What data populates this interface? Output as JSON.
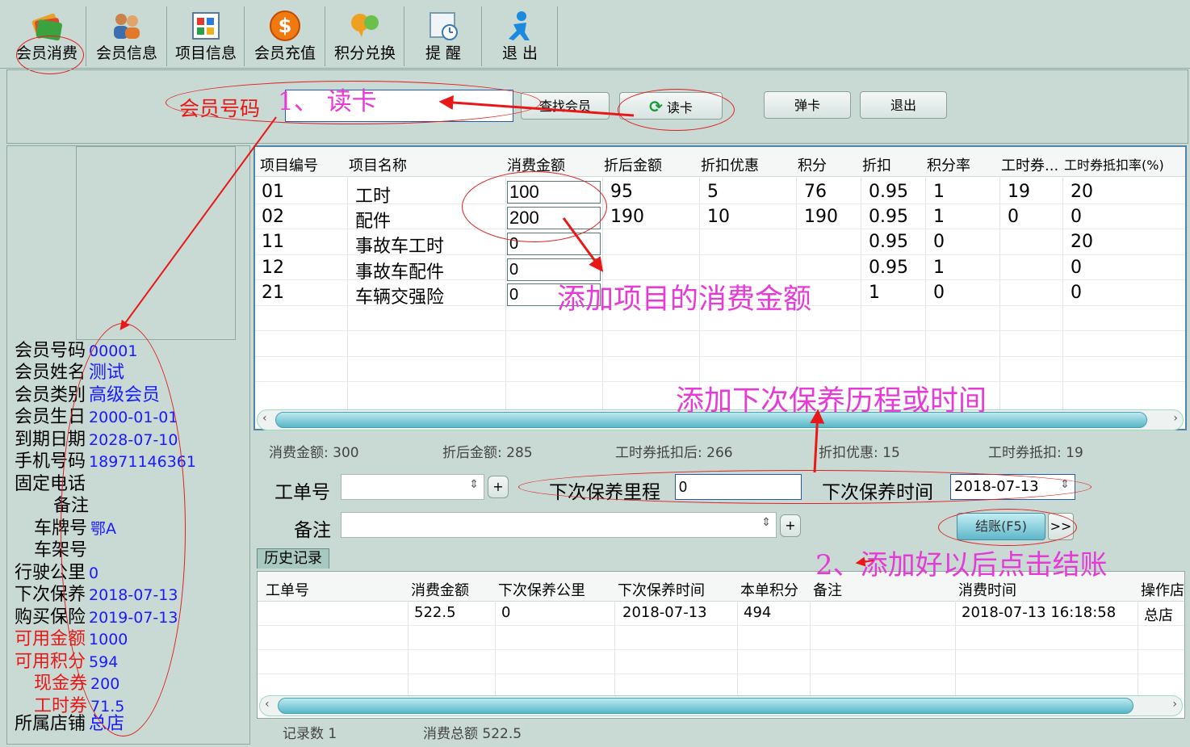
{
  "toolbar": {
    "items": [
      {
        "label": "会员消费",
        "icon": "cards-icon"
      },
      {
        "label": "会员信息",
        "icon": "users-icon"
      },
      {
        "label": "项目信息",
        "icon": "grid-icon"
      },
      {
        "label": "会员充值",
        "icon": "dollar-coin-icon"
      },
      {
        "label": "积分兑换",
        "icon": "chat-bubbles-icon"
      },
      {
        "label": "提 醒",
        "icon": "reminder-icon"
      },
      {
        "label": "退 出",
        "icon": "exit-person-icon"
      }
    ]
  },
  "header": {
    "member_no_label": "会员号码",
    "member_no_value": "",
    "find_button": "查找会员",
    "read_card_button": "读卡",
    "eject_button": "弹卡",
    "exit_button": "退出"
  },
  "member": {
    "fields": [
      {
        "label": "会员号码",
        "value": "00001",
        "red": false
      },
      {
        "label": "会员姓名",
        "value": "测试",
        "red": false
      },
      {
        "label": "会员类别",
        "value": "高级会员",
        "red": false
      },
      {
        "label": "会员生日",
        "value": "2000-01-01",
        "red": false
      },
      {
        "label": "到期日期",
        "value": "2028-07-10",
        "red": false
      },
      {
        "label": "手机号码",
        "value": "18971146361",
        "red": false
      },
      {
        "label": "固定电话",
        "value": "",
        "red": false
      },
      {
        "label": "备注",
        "value": "",
        "red": false
      },
      {
        "label": "车牌号",
        "value": "鄂A",
        "red": false
      },
      {
        "label": "车架号",
        "value": "",
        "red": false
      },
      {
        "label": "行驶公里",
        "value": "0",
        "red": false
      },
      {
        "label": "下次保养",
        "value": "2018-07-13",
        "red": false
      },
      {
        "label": "购买保险",
        "value": "2019-07-13",
        "red": false
      },
      {
        "label": "可用金额",
        "value": "1000",
        "red": true
      },
      {
        "label": "可用积分",
        "value": "594",
        "red": true
      },
      {
        "label": "现金券",
        "value": "200",
        "red": true
      },
      {
        "label": "工时券",
        "value": "71.5",
        "red": true
      },
      {
        "label": "所属店铺",
        "value": "总店",
        "red": false
      }
    ]
  },
  "items_table": {
    "headers": [
      "项目编号",
      "项目名称",
      "消费金额",
      "折后金额",
      "折扣优惠",
      "积分",
      "折扣",
      "积分率",
      "工时券...",
      "工时券抵扣率(%)"
    ],
    "rows": [
      [
        "01",
        "工时",
        "100",
        "95",
        "5",
        "76",
        "0.95",
        "1",
        "19",
        "20"
      ],
      [
        "02",
        "配件",
        "200",
        "190",
        "10",
        "190",
        "0.95",
        "1",
        "0",
        "0"
      ],
      [
        "11",
        "事故车工时",
        "0",
        "",
        "",
        "",
        "0.95",
        "0",
        "",
        "20"
      ],
      [
        "12",
        "事故车配件",
        "0",
        "",
        "",
        "",
        "0.95",
        "1",
        "",
        "0"
      ],
      [
        "21",
        "车辆交强险",
        "0",
        "",
        "",
        "",
        "1",
        "0",
        "",
        "0"
      ]
    ]
  },
  "summary": {
    "total": "消费金额: 300",
    "after_discount": "折后金额: 285",
    "after_voucher": "工时券抵扣后: 266",
    "discount": "折扣优惠: 15",
    "voucher": "工时券抵扣: 19"
  },
  "form": {
    "order_label": "工单号",
    "order_value": "",
    "next_km_label": "下次保养里程",
    "next_km_value": "0",
    "next_time_label": "下次保养时间",
    "next_time_value": "2018-07-13",
    "remark_label": "备注",
    "remark_value": "",
    "checkout_button": "结账(F5)",
    "more_button": ">>"
  },
  "history": {
    "tab": "历史记录",
    "headers": [
      "工单号",
      "消费金额",
      "下次保养公里",
      "下次保养时间",
      "本单积分",
      "备注",
      "消费时间",
      "操作店"
    ],
    "rows": [
      [
        "",
        "522.5",
        "0",
        "2018-07-13",
        "494",
        "",
        "2018-07-13 16:18:58",
        "总店"
      ]
    ],
    "record_count": "记录数 1",
    "total_amount": "消费总额 522.5"
  },
  "annotations": {
    "read_card": "1、 读卡",
    "add_amount": "添加项目的消费金额",
    "add_next": "添加下次保养历程或时间",
    "checkout": "2、添加好以后点击结账"
  },
  "colors": {
    "background": "#c9d9d3",
    "annotation_red": "#e81818",
    "annotation_magenta": "#e63ad6",
    "value_blue": "#1a1aff",
    "grid_border": "#4f86a8"
  }
}
